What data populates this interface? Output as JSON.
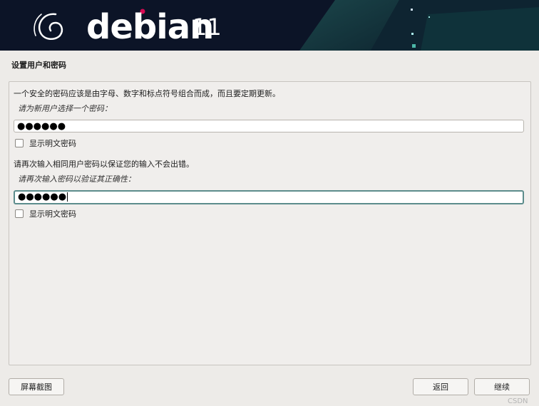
{
  "header": {
    "logo_text": "debian",
    "version": "11"
  },
  "page": {
    "title": "设置用户和密码"
  },
  "form": {
    "intro": "一个安全的密码应该是由字母、数字和标点符号组合而成，而且要定期更新。",
    "password_prompt": "请为新用户选择一个密码：",
    "password_value": "●●●●●●",
    "show_password_label_1": "显示明文密码",
    "verify_intro": "请再次输入相同用户密码以保证您的输入不会出错。",
    "verify_prompt": "请再次输入密码以验证其正确性：",
    "verify_value": "●●●●●●",
    "show_password_label_2": "显示明文密码"
  },
  "buttons": {
    "screenshot": "屏幕截图",
    "back": "返回",
    "continue": "继续"
  },
  "watermark": "CSDN",
  "colors": {
    "header_bg": "#0c1427",
    "accent_red": "#d70a53",
    "focus_border": "#5c8c8c"
  }
}
